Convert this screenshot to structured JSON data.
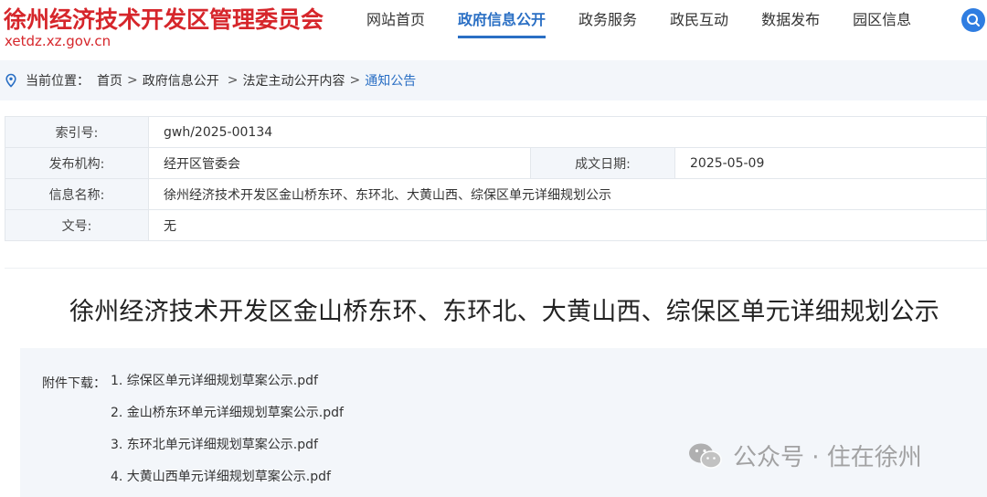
{
  "header": {
    "site_title": "徐州经济技术开发区管理委员会",
    "site_domain": "xetdz.xz.gov.cn",
    "nav": [
      {
        "label": "网站首页",
        "active": false
      },
      {
        "label": "政府信息公开",
        "active": true
      },
      {
        "label": "政务服务",
        "active": false
      },
      {
        "label": "政民互动",
        "active": false
      },
      {
        "label": "数据发布",
        "active": false
      },
      {
        "label": "园区信息",
        "active": false
      }
    ],
    "search_icon": "search-icon"
  },
  "breadcrumb": {
    "prefix": "当前位置：",
    "items": [
      "首页",
      "政府信息公开",
      "法定主动公开内容",
      "通知公告"
    ],
    "separator": ">"
  },
  "info": {
    "index_label": "索引号:",
    "index_value": "gwh/2025-00134",
    "publisher_label": "发布机构:",
    "publisher_value": "经开区管委会",
    "date_label": "成文日期:",
    "date_value": "2025-05-09",
    "name_label": "信息名称:",
    "name_value": "徐州经济技术开发区金山桥东环、东环北、大黄山西、综保区单元详细规划公示",
    "docno_label": "文号:",
    "docno_value": "无"
  },
  "document": {
    "title": "徐州经济技术开发区金山桥东环、东环北、大黄山西、综保区单元详细规划公示"
  },
  "attachments": {
    "label": "附件下载：",
    "items": [
      "1. 综保区单元详细规划草案公示.pdf",
      "2. 金山桥东环单元详细规划草案公示.pdf",
      "3. 东环北单元详细规划草案公示.pdf",
      "4. 大黄山西单元详细规划草案公示.pdf"
    ]
  },
  "watermark": {
    "text": "公众号 · 住在徐州"
  },
  "colors": {
    "brand_red": "#d6262b",
    "accent_blue": "#2a6fc4",
    "panel_bg": "#f3f6fa"
  }
}
